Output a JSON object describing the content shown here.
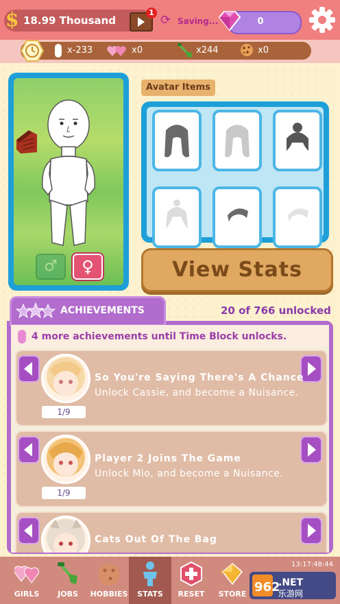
{
  "header": {
    "money": "18.99 Thousand",
    "video_badge": "1",
    "saving_text": "Saving...",
    "gems": "0"
  },
  "resources": [
    {
      "icon": "time-block-icon",
      "value": ""
    },
    {
      "icon": "tube-icon",
      "value": "x-233"
    },
    {
      "icon": "hearts-icon",
      "value": "x0"
    },
    {
      "icon": "shovel-icon",
      "value": "x244"
    },
    {
      "icon": "cookie-icon",
      "value": "x0"
    }
  ],
  "avatar": {
    "male_symbol": "♂",
    "female_symbol": "♀"
  },
  "avatar_items": {
    "label": "Avatar Items",
    "items": [
      "hair-long-dark-icon",
      "hair-long-light-icon",
      "hair-bun-icon",
      "hair-tuft-icon",
      "hair-bangs-dark-icon",
      "hair-bangs-light-icon"
    ]
  },
  "view_stats_label": "View Stats",
  "achievements": {
    "tab_label": "ACHIEVEMENTS",
    "count_text": "20 of 766 unlocked",
    "unlock_text": "4 more achievements until Time Block unlocks.",
    "cards": [
      {
        "title": "So You're Saying There's A Chance",
        "desc": "Unlock Cassie, and become a Nuisance.",
        "progress": "1/9",
        "portrait": "cassie-portrait"
      },
      {
        "title": "Player 2 Joins The Game",
        "desc": "Unlock Mio, and become a Nuisance.",
        "progress": "1/9",
        "portrait": "mio-portrait"
      },
      {
        "title": "Cats Out Of The Bag",
        "desc": "",
        "progress": "",
        "portrait": "cat-girl-portrait"
      }
    ]
  },
  "nav": [
    {
      "label": "GIRLS",
      "icon": "hearts-icon"
    },
    {
      "label": "JOBS",
      "icon": "shovel-icon"
    },
    {
      "label": "HOBBIES",
      "icon": "cookie-icon"
    },
    {
      "label": "STATS",
      "icon": "person-icon"
    },
    {
      "label": "RESET",
      "icon": "reset-icon"
    },
    {
      "label": "STORE",
      "icon": "store-gem-icon"
    }
  ],
  "status_time": "13:17:48:44",
  "watermark": {
    "brand": "962.NET",
    "sub": "乐游网"
  },
  "colors": {
    "topbar": "#f07f7f",
    "purple": "#b26ccd",
    "blue_frame": "#1e9fd8",
    "stats_button": "#e0a860"
  }
}
